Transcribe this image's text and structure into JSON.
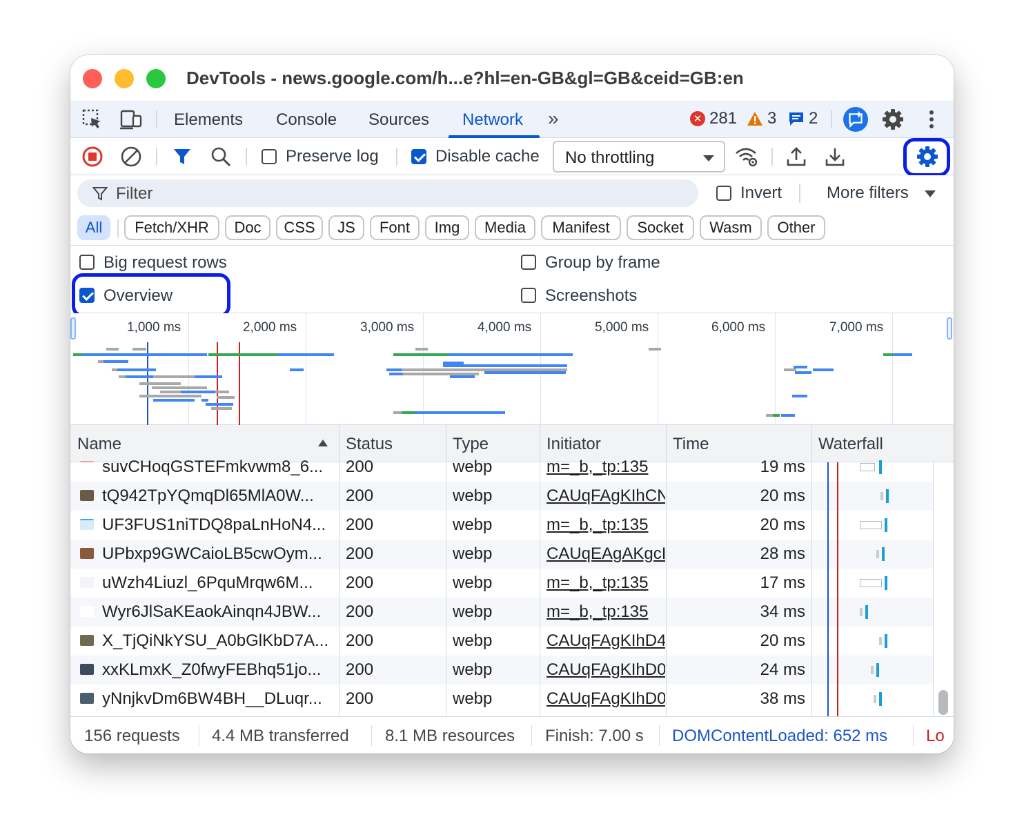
{
  "window": {
    "title": "DevTools - news.google.com/h...e?hl=en-GB&gl=GB&ceid=GB:en"
  },
  "tabs": {
    "items": [
      "Elements",
      "Console",
      "Sources",
      "Network"
    ],
    "active": "Network",
    "more_label": "»",
    "errors": "281",
    "warnings": "3",
    "messages": "2"
  },
  "toolbar": {
    "preserve_log": "Preserve log",
    "preserve_log_checked": false,
    "disable_cache": "Disable cache",
    "disable_cache_checked": true,
    "throttling": "No throttling"
  },
  "filter": {
    "placeholder": "Filter",
    "invert": "Invert",
    "more_filters": "More filters"
  },
  "type_filters": [
    "All",
    "Fetch/XHR",
    "Doc",
    "CSS",
    "JS",
    "Font",
    "Img",
    "Media",
    "Manifest",
    "Socket",
    "Wasm",
    "Other"
  ],
  "settings": {
    "big_request_rows": "Big request rows",
    "overview": "Overview",
    "overview_checked": true,
    "group_by_frame": "Group by frame",
    "screenshots": "Screenshots"
  },
  "overview": {
    "ticks": [
      "1,000 ms",
      "2,000 ms",
      "3,000 ms",
      "4,000 ms",
      "5,000 ms",
      "6,000 ms",
      "7,000 ms"
    ]
  },
  "table": {
    "columns": [
      "Name",
      "Status",
      "Type",
      "Initiator",
      "Time",
      "Waterfall"
    ],
    "rows": [
      {
        "name": "suvCHoqGSTEFmkvwm8_6...",
        "status": "200",
        "type": "webp",
        "initiator": "m=_b,_tp:135",
        "time": "19 ms"
      },
      {
        "name": "tQ942TpYQmqDl65MlA0W...",
        "status": "200",
        "type": "webp",
        "initiator": "CAUqFAgKIhCN",
        "time": "20 ms"
      },
      {
        "name": "UF3FUS1niTDQ8paLnHoN4...",
        "status": "200",
        "type": "webp",
        "initiator": "m=_b,_tp:135",
        "time": "20 ms"
      },
      {
        "name": "UPbxp9GWCaioLB5cwOym...",
        "status": "200",
        "type": "webp",
        "initiator": "CAUqEAgAKgcI",
        "time": "28 ms"
      },
      {
        "name": "uWzh4Liuzl_6PquMrqw6M...",
        "status": "200",
        "type": "webp",
        "initiator": "m=_b,_tp:135",
        "time": "17 ms"
      },
      {
        "name": "Wyr6JlSaKEaokAinqn4JBW...",
        "status": "200",
        "type": "webp",
        "initiator": "m=_b,_tp:135",
        "time": "34 ms"
      },
      {
        "name": "X_TjQiNkYSU_A0bGlKbD7A...",
        "status": "200",
        "type": "webp",
        "initiator": "CAUqFAgKIhD4",
        "time": "20 ms"
      },
      {
        "name": "xxKLmxK_Z0fwyFEBhq51jo...",
        "status": "200",
        "type": "webp",
        "initiator": "CAUqFAgKIhD0",
        "time": "24 ms"
      },
      {
        "name": "yNnjkvDm6BW4BH__DLuqr...",
        "status": "200",
        "type": "webp",
        "initiator": "CAUqFAgKIhD0",
        "time": "38 ms"
      }
    ]
  },
  "status": {
    "requests": "156 requests",
    "transferred": "4.4 MB transferred",
    "resources": "8.1 MB resources",
    "finish": "Finish: 7.00 s",
    "dom_content_loaded": "DOMContentLoaded: 652 ms",
    "load": "Lo"
  },
  "colors": {
    "accent": "#0b57d0",
    "highlight": "#0b1de8",
    "error": "#dc362e",
    "warning": "#e37400",
    "dcl_line": "#1a56c8",
    "load_line": "#c5221f",
    "bar_blue": "#4285f4",
    "bar_green": "#34a853",
    "bar_gray": "#a8a8a8"
  }
}
